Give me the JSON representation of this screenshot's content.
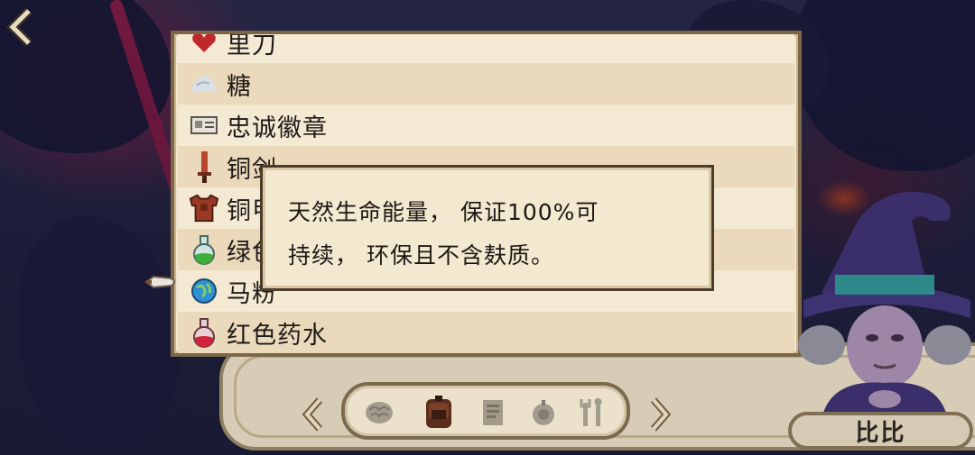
{
  "inventory": {
    "items": [
      {
        "label": "里刀",
        "icon": "heart-icon"
      },
      {
        "label": "糖",
        "icon": "sugar-icon"
      },
      {
        "label": "忠诚徽章",
        "icon": "badge-icon"
      },
      {
        "label": "铜剑",
        "icon": "sword-icon"
      },
      {
        "label": "铜甲",
        "icon": "armor-icon"
      },
      {
        "label": "绿色药水",
        "icon": "green-potion-icon"
      },
      {
        "label": "马粉",
        "icon": "globe-orb-icon"
      },
      {
        "label": "红色药水",
        "icon": "red-potion-icon"
      }
    ],
    "selected_index": 6
  },
  "tooltip": {
    "line1": "天然生命能量， 保证100%可",
    "line2": "持续， 环保且不含麸质。"
  },
  "category_tabs": [
    {
      "icon": "brain-icon"
    },
    {
      "icon": "backpack-icon",
      "active": true
    },
    {
      "icon": "scroll-icon"
    },
    {
      "icon": "bomb-icon"
    },
    {
      "icon": "tools-icon"
    }
  ],
  "npc": {
    "name": "比比"
  },
  "colors": {
    "panel": "#f1e5cc",
    "border": "#7c6648",
    "text": "#1e1a18"
  }
}
